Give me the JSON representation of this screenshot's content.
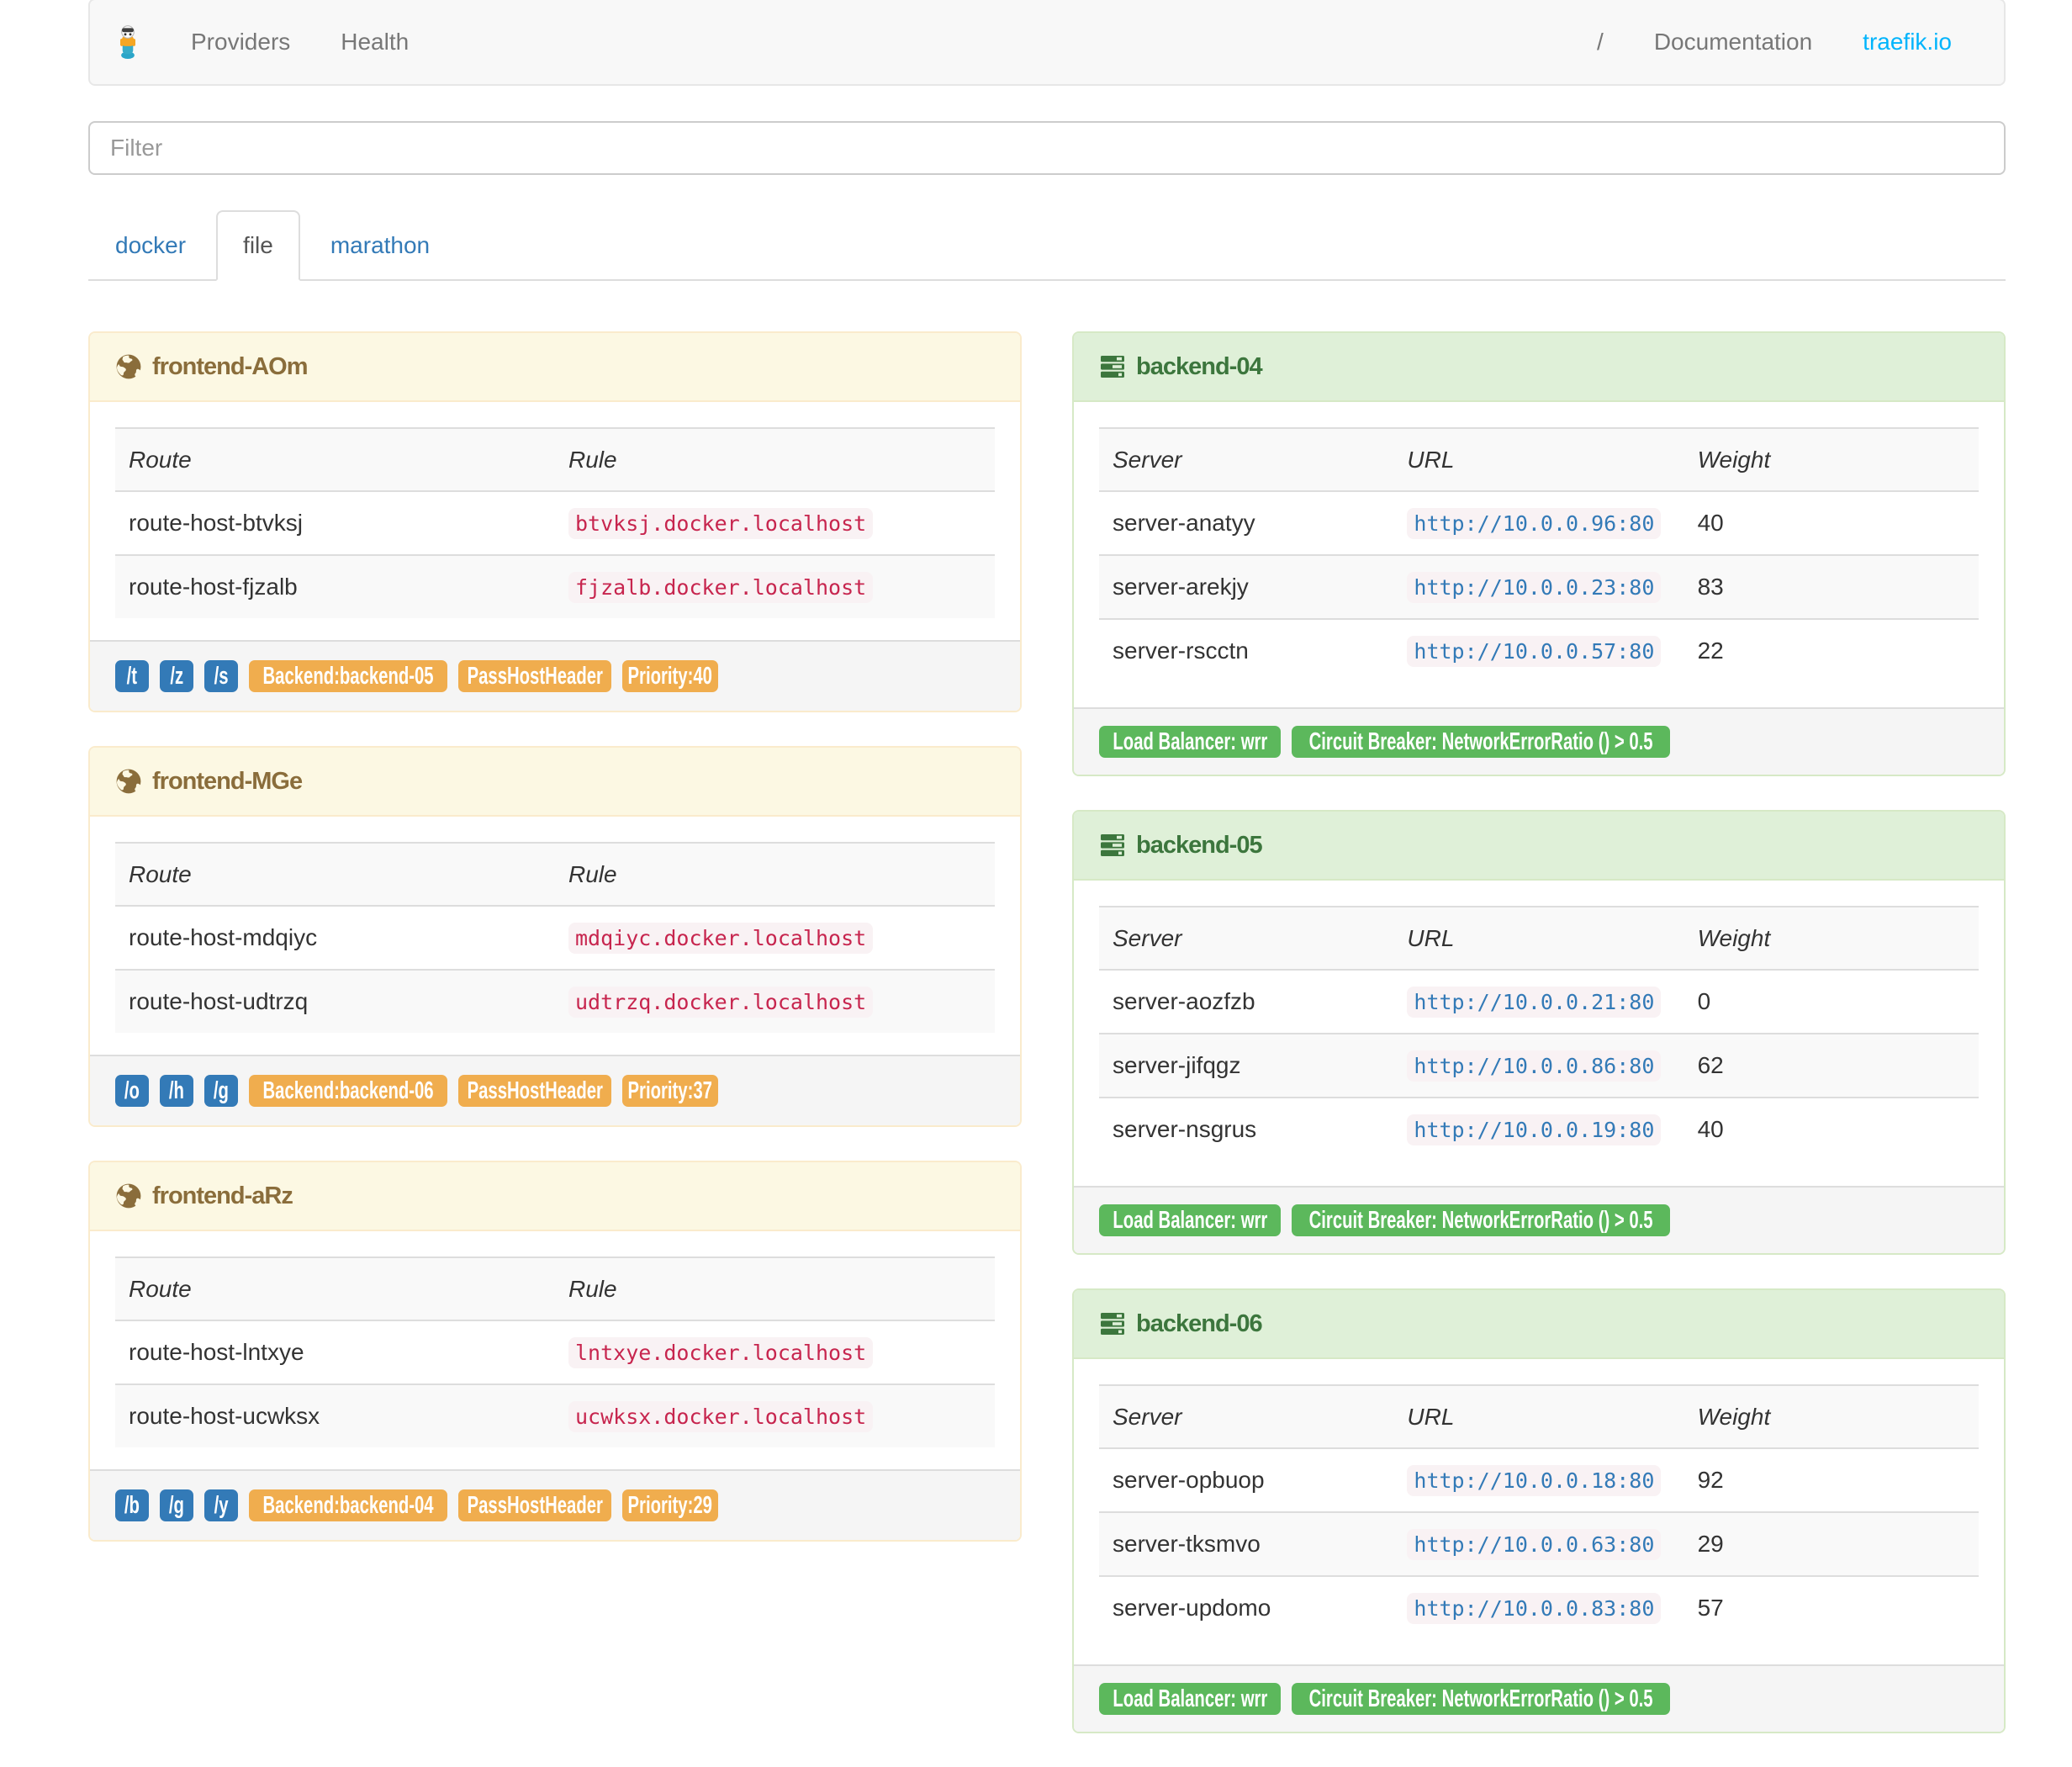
{
  "navbar": {
    "links": [
      {
        "label": "Providers"
      },
      {
        "label": "Health"
      }
    ],
    "right": {
      "separator": "/",
      "doc_label": "Documentation",
      "site_label": "traefik.io"
    }
  },
  "filter": {
    "placeholder": "Filter"
  },
  "tabs": [
    {
      "label": "docker",
      "active": false
    },
    {
      "label": "file",
      "active": true
    },
    {
      "label": "marathon",
      "active": false
    }
  ],
  "frontend_table_headers": {
    "route": "Route",
    "rule": "Rule"
  },
  "backend_table_headers": {
    "server": "Server",
    "url": "URL",
    "weight": "Weight"
  },
  "frontends": [
    {
      "title": "frontend-AOm",
      "routes": [
        {
          "route": "route-host-btvksj",
          "rule": "btvksj.docker.localhost"
        },
        {
          "route": "route-host-fjzalb",
          "rule": "fjzalb.docker.localhost"
        }
      ],
      "path_badges": [
        "/t",
        "/z",
        "/s"
      ],
      "badges": [
        "Backend:backend-05",
        "PassHostHeader",
        "Priority:40"
      ]
    },
    {
      "title": "frontend-MGe",
      "routes": [
        {
          "route": "route-host-mdqiyc",
          "rule": "mdqiyc.docker.localhost"
        },
        {
          "route": "route-host-udtrzq",
          "rule": "udtrzq.docker.localhost"
        }
      ],
      "path_badges": [
        "/o",
        "/h",
        "/g"
      ],
      "badges": [
        "Backend:backend-06",
        "PassHostHeader",
        "Priority:37"
      ]
    },
    {
      "title": "frontend-aRz",
      "routes": [
        {
          "route": "route-host-lntxye",
          "rule": "lntxye.docker.localhost"
        },
        {
          "route": "route-host-ucwksx",
          "rule": "ucwksx.docker.localhost"
        }
      ],
      "path_badges": [
        "/b",
        "/g",
        "/y"
      ],
      "badges": [
        "Backend:backend-04",
        "PassHostHeader",
        "Priority:29"
      ]
    }
  ],
  "backends": [
    {
      "title": "backend-04",
      "servers": [
        {
          "server": "server-anatyy",
          "url": "http://10.0.0.96:80",
          "weight": "40"
        },
        {
          "server": "server-arekjy",
          "url": "http://10.0.0.23:80",
          "weight": "83"
        },
        {
          "server": "server-rscctn",
          "url": "http://10.0.0.57:80",
          "weight": "22"
        }
      ],
      "badges": [
        "Load Balancer: wrr",
        "Circuit Breaker: NetworkErrorRatio () > 0.5"
      ]
    },
    {
      "title": "backend-05",
      "servers": [
        {
          "server": "server-aozfzb",
          "url": "http://10.0.0.21:80",
          "weight": "0"
        },
        {
          "server": "server-jifqgz",
          "url": "http://10.0.0.86:80",
          "weight": "62"
        },
        {
          "server": "server-nsgrus",
          "url": "http://10.0.0.19:80",
          "weight": "40"
        }
      ],
      "badges": [
        "Load Balancer: wrr",
        "Circuit Breaker: NetworkErrorRatio () > 0.5"
      ]
    },
    {
      "title": "backend-06",
      "servers": [
        {
          "server": "server-opbuop",
          "url": "http://10.0.0.18:80",
          "weight": "92"
        },
        {
          "server": "server-tksmvo",
          "url": "http://10.0.0.63:80",
          "weight": "29"
        },
        {
          "server": "server-updomo",
          "url": "http://10.0.0.83:80",
          "weight": "57"
        }
      ],
      "badges": [
        "Load Balancer: wrr",
        "Circuit Breaker: NetworkErrorRatio () > 0.5"
      ]
    }
  ]
}
